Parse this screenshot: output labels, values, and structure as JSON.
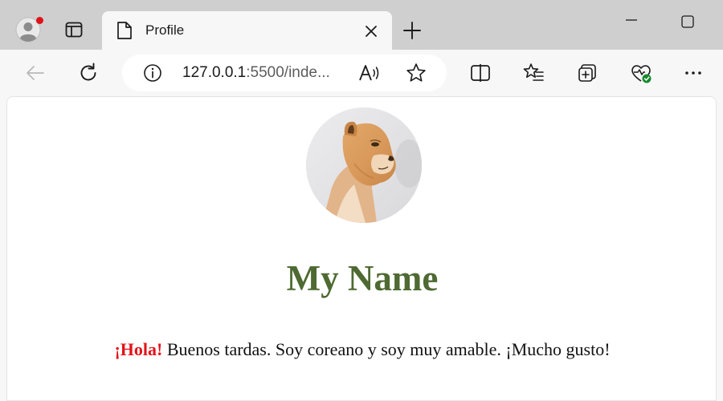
{
  "browser": {
    "tab": {
      "title": "Profile"
    },
    "address_bar": {
      "host": "127.0.0.1",
      "rest": ":5500/inde..."
    }
  },
  "page": {
    "avatar_alt": "lioness",
    "title": "My Name",
    "greeting_highlight": "¡Hola!",
    "greeting_text": " Buenos tardas. Soy coreano y soy muy amable. ¡Mucho gusto!"
  },
  "colors": {
    "title": "#4e6a32",
    "highlight": "#e3131a"
  },
  "icons": [
    "profile-avatar-icon",
    "tab-actions-icon",
    "page-icon",
    "close-icon",
    "plus-icon",
    "minimize-icon",
    "maximize-icon",
    "back-arrow-icon",
    "refresh-icon",
    "info-icon",
    "read-aloud-icon",
    "star-icon",
    "split-screen-icon",
    "favorites-icon",
    "collections-icon",
    "browser-essentials-icon",
    "more-icon"
  ]
}
